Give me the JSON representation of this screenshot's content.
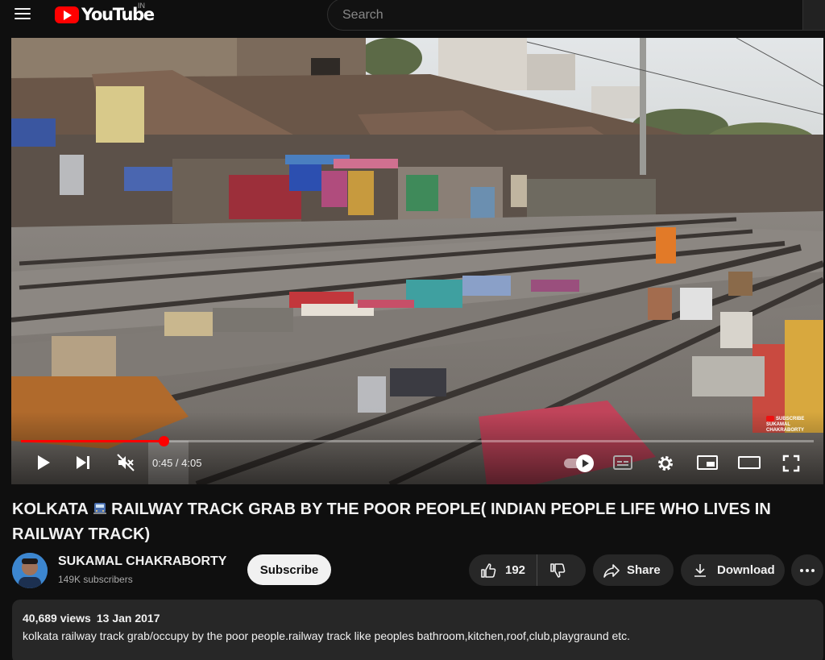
{
  "header": {
    "logo_text": "YouTube",
    "region": "IN",
    "search_placeholder": "Search"
  },
  "player": {
    "current_time": "0:45",
    "duration": "4:05",
    "progress_fraction": 0.18,
    "watermark": [
      "SUBSCRIBE",
      "SUKAMAL CHAKRABORTY"
    ],
    "accent_color": "#ff0000"
  },
  "video": {
    "title": "KOLKATA 🚂 RAILWAY TRACK GRAB BY THE POOR PEOPLE( INDIAN PEOPLE LIFE WHO LIVES IN RAILWAY TRACK)",
    "title_before_icon": "KOLKATA ",
    "title_after_icon": " RAILWAY TRACK GRAB BY THE POOR PEOPLE( INDIAN PEOPLE LIFE WHO LIVES IN RAILWAY TRACK)"
  },
  "channel": {
    "name": "SUKAMAL CHAKRABORTY",
    "subscribers": "149K subscribers",
    "subscribe_label": "Subscribe"
  },
  "actions": {
    "likes": "192",
    "share_label": "Share",
    "download_label": "Download",
    "icons": [
      "thumbs-up-icon",
      "thumbs-down-icon",
      "share-arrow-icon",
      "download-icon",
      "more-icon"
    ]
  },
  "description": {
    "views": "40,689 views",
    "date": "13 Jan 2017",
    "text": "kolkata railway track grab/occupy  by the poor people.railway track like peoples bathroom,kitchen,roof,club,playgraund etc."
  }
}
